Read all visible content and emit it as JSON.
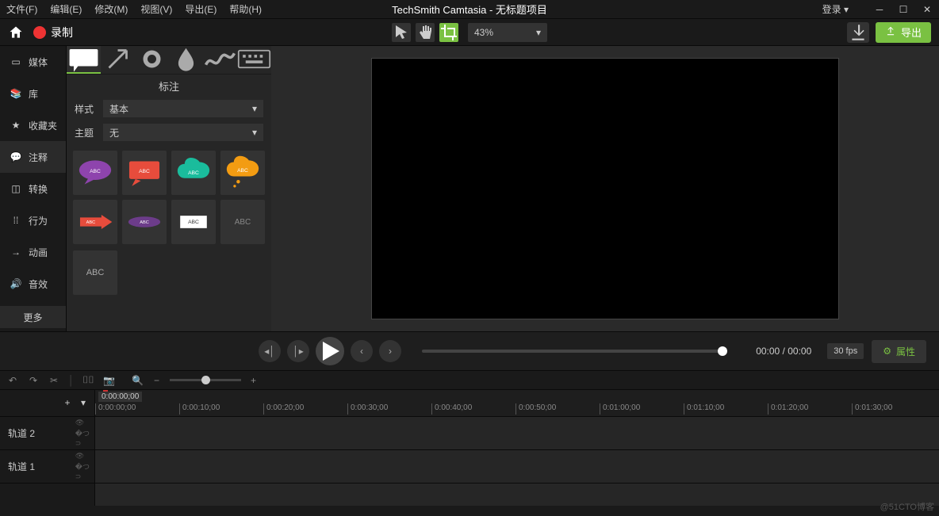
{
  "menu": {
    "file": "文件(F)",
    "edit": "编辑(E)",
    "modify": "修改(M)",
    "view": "视图(V)",
    "export": "导出(E)",
    "help": "帮助(H)"
  },
  "title": "TechSmith Camtasia - 无标题项目",
  "login": "登录 ▾",
  "record": "录制",
  "zoom": "43%",
  "exportBtn": "导出",
  "sidebar": {
    "items": [
      {
        "label": "媒体"
      },
      {
        "label": "库"
      },
      {
        "label": "收藏夹"
      },
      {
        "label": "注释"
      },
      {
        "label": "转换"
      },
      {
        "label": "行为"
      },
      {
        "label": "动画"
      },
      {
        "label": "音效"
      }
    ],
    "more": "更多"
  },
  "panel": {
    "title": "标注",
    "styleLabel": "样式",
    "styleValue": "基本",
    "themeLabel": "主题",
    "themeValue": "无"
  },
  "thumbtext": "ABC",
  "playback": {
    "time": "00:00 / 00:00",
    "fps": "30 fps",
    "props": "属性"
  },
  "timeline": {
    "playhead": "0:00:00;00",
    "ticks": [
      "0:00:00;00",
      "0:00:10;00",
      "0:00:20;00",
      "0:00:30;00",
      "0:00:40;00",
      "0:00:50;00",
      "0:01:00;00",
      "0:01:10;00",
      "0:01:20;00",
      "0:01:30;00"
    ],
    "tracks": [
      "轨道 2",
      "轨道 1"
    ]
  },
  "watermark": "@51CTO博客"
}
